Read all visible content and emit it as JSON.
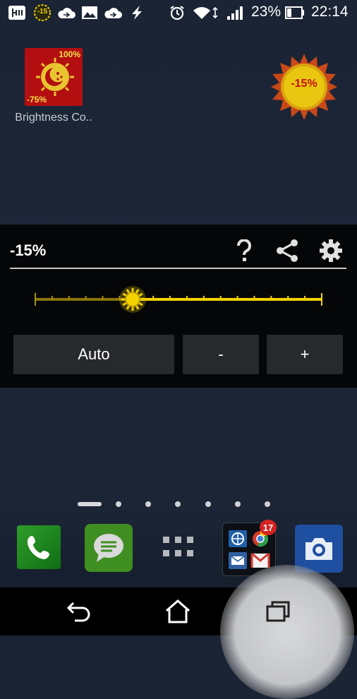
{
  "status_bar": {
    "icons": [
      "usb-debug-icon",
      "brightness-widget-icon",
      "cloud-sync-icon",
      "image-icon",
      "cloud-sync-icon",
      "flash-icon"
    ],
    "brightness_badge": "-15",
    "right_icons": [
      "alarm-icon",
      "wifi-icon",
      "signal-icon",
      "battery-icon"
    ],
    "battery": "23%",
    "time": "22:14"
  },
  "home": {
    "app": {
      "label": "Brightness Co..",
      "top_pct": "100%",
      "bottom_pct": "-75%"
    },
    "sun_widget_value": "-15%"
  },
  "panel": {
    "level": "-15%",
    "toolbar": [
      "help-icon",
      "share-icon",
      "settings-icon"
    ],
    "slider": {
      "value_fraction": 0.34,
      "ticks": 18
    },
    "auto_label": "Auto",
    "minus_label": "-",
    "plus_label": "+"
  },
  "pager": {
    "pages": 7,
    "active": 0
  },
  "dock": {
    "icons": [
      "phone-icon",
      "messaging-icon",
      "app-drawer-icon",
      "folder-icon",
      "camera-icon"
    ],
    "folder_badge": "17"
  },
  "navbar": {
    "buttons": [
      "back-icon",
      "home-icon",
      "recent-apps-icon"
    ]
  },
  "colors": {
    "accent_yellow": "#f2d100",
    "tile_red": "#b30f10"
  }
}
